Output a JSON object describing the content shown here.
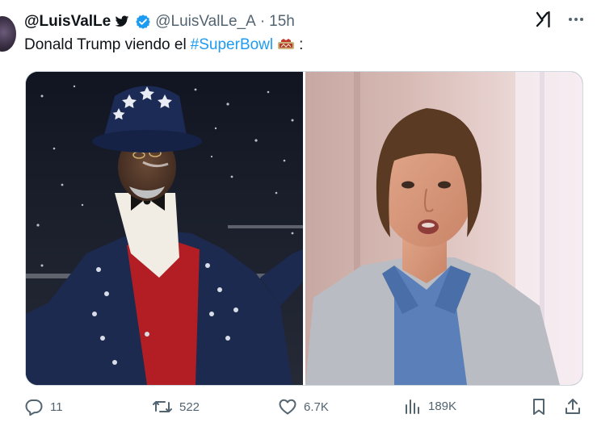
{
  "author": {
    "display_name": "@LuisValLe",
    "handle": "@LuisValLe_A",
    "separator": "·",
    "time": "15h"
  },
  "tweet": {
    "text_before": "Donald Trump viendo el",
    "hashtag": "#SuperBowl",
    "text_after": ":"
  },
  "stats": {
    "replies": "11",
    "reposts": "522",
    "likes": "6.7K",
    "views": "189K"
  },
  "colors": {
    "text": "#0f1419",
    "secondary": "#536471",
    "link": "#1d9bf0",
    "verified": "#1d9bf0"
  },
  "icons": [
    "bird-icon",
    "verified-icon",
    "grok-icon",
    "more-icon",
    "superbowl-logo-icon",
    "reply-icon",
    "repost-icon",
    "like-icon",
    "views-icon",
    "bookmark-icon",
    "share-icon"
  ]
}
